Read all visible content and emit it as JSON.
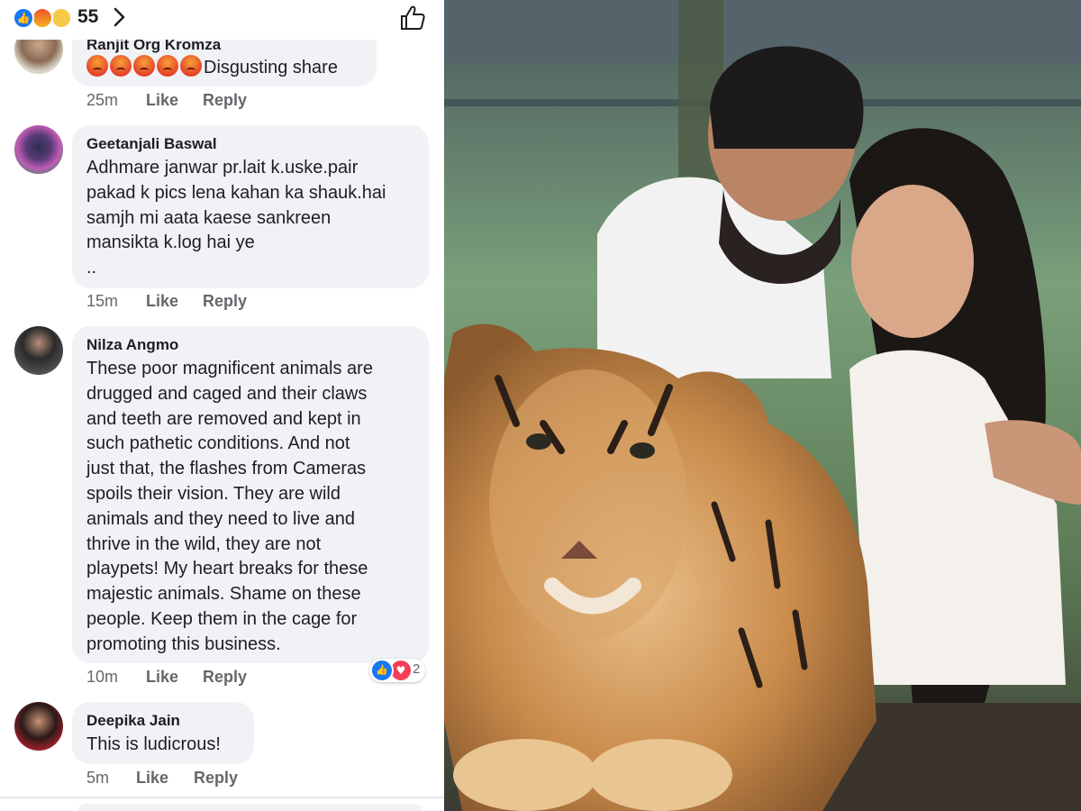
{
  "reactions": {
    "count": "55",
    "icons": [
      "like-icon",
      "angry-icon",
      "sad-icon"
    ]
  },
  "comments": [
    {
      "name": "Ranjit Org Kromza",
      "text_lines": [
        "Disgusting share"
      ],
      "emoji_prefix": [
        "angry-emoji",
        "angry-emoji",
        "angry-emoji",
        "angry-emoji",
        "angry-emoji"
      ],
      "time": "25m",
      "like": "Like",
      "reply": "Reply"
    },
    {
      "name": "Geetanjali Baswal",
      "text_lines": [
        "Adhmare janwar pr.lait k.uske.pair",
        "pakad k pics lena kahan ka shauk.hai",
        "samjh mi aata kaese sankreen",
        "mansikta k.log hai ye",
        ".."
      ],
      "time": "15m",
      "like": "Like",
      "reply": "Reply"
    },
    {
      "name": "Nilza Angmo",
      "text_lines": [
        "These poor magnificent animals are",
        "drugged and caged and their claws",
        "and teeth are removed and kept in",
        "such pathetic conditions. And not",
        "just that, the flashes from Cameras",
        "spoils their vision. They are wild",
        "animals and they need to live and",
        "thrive in the wild, they are not",
        "playpets! My heart breaks for these",
        "majestic animals. Shame on these",
        "people. Keep them in the cage for",
        "promoting this business."
      ],
      "time": "10m",
      "like": "Like",
      "reply": "Reply",
      "reaction_count": "2"
    },
    {
      "name": "Deepika Jain",
      "text_lines": [
        "This is ludicrous!"
      ],
      "time": "5m",
      "like": "Like",
      "reply": "Reply"
    }
  ],
  "colors": {
    "like_blue": "#1877f2",
    "love_red": "#f33e58",
    "bubble": "#f0f2f5",
    "meta": "#65676b"
  },
  "photo": {
    "subject": "tiger-cub-photo"
  }
}
